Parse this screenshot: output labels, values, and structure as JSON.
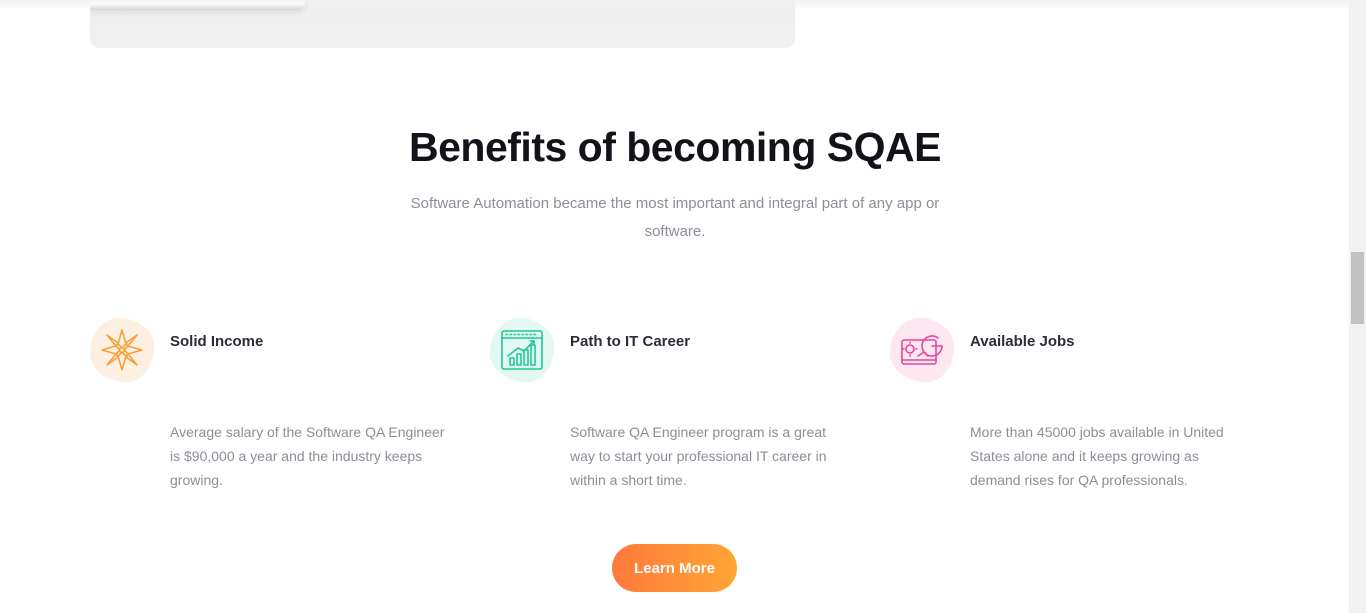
{
  "section": {
    "title": "Benefits of becoming SQAE",
    "subtitle": "Software Automation became the most important and integral part of any app or software."
  },
  "benefits": [
    {
      "title": "Solid Income",
      "text": "Average salary of the Software QA Engineer is $90,000 a year and the industry keeps growing.",
      "icon": "star-flower-icon",
      "color": "#f6a23a",
      "blob_color": "#fdf0e2"
    },
    {
      "title": "Path to IT Career",
      "text": "Software QA Engineer program is a great way to start your professional IT career in within a short time.",
      "icon": "growth-chart-icon",
      "color": "#1fc79a",
      "blob_color": "#e3f8f0"
    },
    {
      "title": "Available Jobs",
      "text": "More than 45000 jobs available in United States alone and it keeps growing as demand rises for QA professionals.",
      "icon": "google-search-icon",
      "color": "#e8479a",
      "blob_color": "#fde7f1"
    }
  ],
  "cta": {
    "label": "Learn More"
  }
}
